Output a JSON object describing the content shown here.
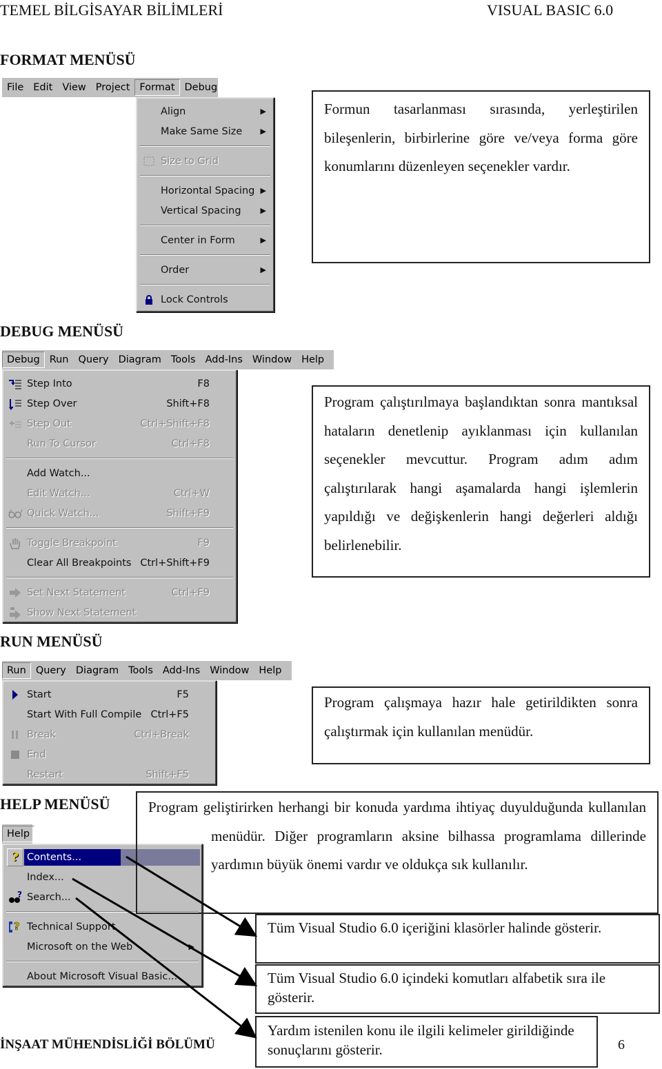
{
  "page_header": {
    "left": "TEMEL BİLGİSAYAR BİLİMLERİ",
    "right": "VISUAL BASIC 6.0"
  },
  "format_section": {
    "title": "FORMAT MENÜSÜ",
    "menubar": [
      "File",
      "Edit",
      "View",
      "Project",
      "Format",
      "Debug"
    ],
    "open_menu": "Format",
    "items": [
      {
        "label": "Align",
        "submenu": true
      },
      {
        "label": "Make Same Size",
        "submenu": true
      },
      {
        "separator": true
      },
      {
        "label": "Size to Grid",
        "disabled": true,
        "icon": "size-to-grid-icon"
      },
      {
        "separator": true
      },
      {
        "label": "Horizontal Spacing",
        "submenu": true
      },
      {
        "label": "Vertical Spacing",
        "submenu": true
      },
      {
        "separator": true
      },
      {
        "label": "Center in Form",
        "submenu": true
      },
      {
        "separator": true
      },
      {
        "label": "Order",
        "submenu": true
      },
      {
        "separator": true
      },
      {
        "label": "Lock Controls",
        "icon": "lock-icon"
      }
    ],
    "description": "Formun tasarlanması sırasında, yerleştirilen bileşenlerin, birbirlerine göre ve/veya forma göre konumlarını düzenleyen seçenekler vardır."
  },
  "debug_section": {
    "title": "DEBUG MENÜSÜ",
    "menubar": [
      "Debug",
      "Run",
      "Query",
      "Diagram",
      "Tools",
      "Add-Ins",
      "Window",
      "Help"
    ],
    "open_menu": "Debug",
    "items": [
      {
        "label": "Step Into",
        "shortcut": "F8",
        "icon": "step-into-icon"
      },
      {
        "label": "Step Over",
        "shortcut": "Shift+F8",
        "icon": "step-over-icon"
      },
      {
        "label": "Step Out",
        "shortcut": "Ctrl+Shift+F8",
        "icon": "step-out-icon",
        "disabled": true
      },
      {
        "label": "Run To Cursor",
        "shortcut": "Ctrl+F8",
        "disabled": true
      },
      {
        "separator": true
      },
      {
        "label": "Add Watch..."
      },
      {
        "label": "Edit Watch...",
        "shortcut": "Ctrl+W",
        "disabled": true
      },
      {
        "label": "Quick Watch...",
        "shortcut": "Shift+F9",
        "icon": "glasses-icon",
        "disabled": true
      },
      {
        "separator": true
      },
      {
        "label": "Toggle Breakpoint",
        "shortcut": "F9",
        "icon": "hand-icon",
        "disabled": true
      },
      {
        "label": "Clear All Breakpoints",
        "shortcut": "Ctrl+Shift+F9"
      },
      {
        "separator": true
      },
      {
        "label": "Set Next Statement",
        "shortcut": "Ctrl+F9",
        "icon": "arrow-right-icon",
        "disabled": true
      },
      {
        "label": "Show Next Statement",
        "icon": "show-next-icon",
        "disabled": true
      }
    ],
    "description": "Program çalıştırılmaya başlandıktan sonra mantıksal hataların denetlenip ayıklanması için kullanılan seçenekler mevcuttur. Program adım adım çalıştırılarak hangi aşamalarda hangi işlemlerin yapıldığı ve değişkenlerin hangi değerleri aldığı belirlenebilir."
  },
  "run_section": {
    "title": "RUN MENÜSÜ",
    "menubar": [
      "Run",
      "Query",
      "Diagram",
      "Tools",
      "Add-Ins",
      "Window",
      "Help"
    ],
    "open_menu": "Run",
    "items": [
      {
        "label": "Start",
        "shortcut": "F5",
        "icon": "play-icon"
      },
      {
        "label": "Start With Full Compile",
        "shortcut": "Ctrl+F5"
      },
      {
        "label": "Break",
        "shortcut": "Ctrl+Break",
        "icon": "pause-icon",
        "disabled": true
      },
      {
        "label": "End",
        "icon": "stop-icon",
        "disabled": true
      },
      {
        "label": "Restart",
        "shortcut": "Shift+F5",
        "disabled": true
      }
    ],
    "description": "Program çalışmaya hazır hale getirildikten sonra çalıştırmak için kullanılan menüdür."
  },
  "help_section": {
    "title": "HELP MENÜSÜ",
    "menubar": [
      "Help"
    ],
    "open_menu": "Help",
    "items": [
      {
        "label": "Contents...",
        "icon": "question-icon",
        "highlighted": true
      },
      {
        "label": "Index..."
      },
      {
        "label": "Search...",
        "icon": "binoculars-icon"
      },
      {
        "separator": true
      },
      {
        "label": "Technical Support",
        "icon": "phone-help-icon"
      },
      {
        "label": "Microsoft on the Web",
        "submenu": true
      },
      {
        "separator": true
      },
      {
        "label": "About Microsoft Visual Basic..."
      }
    ],
    "description": "Program geliştirirken herhangi bir konuda yardıma ihtiyaç duyulduğunda kullanılan menüdür. Diğer programların aksine bilhassa programlama dillerinde yardımın büyük önemi vardır ve oldukça sık kullanılır.",
    "callouts": [
      {
        "target": "Contents...",
        "text": "Tüm Visual Studio 6.0 içeriğini klasörler halinde gösterir."
      },
      {
        "target": "Index...",
        "text": "Tüm Visual Studio 6.0 içindeki komutları alfabetik sıra ile gösterir."
      },
      {
        "target": "Search...",
        "text": "Yardım istenilen konu ile ilgili kelimeler girildiğinde sonuçlarını gösterir."
      }
    ]
  },
  "page_footer": {
    "left": "İNŞAAT MÜHENDİSLİĞİ BÖLÜMÜ",
    "page_number": "6"
  },
  "colors": {
    "menu_bg": "#c0c0c0",
    "highlight": "#00007f",
    "disabled_text": "#888888"
  }
}
